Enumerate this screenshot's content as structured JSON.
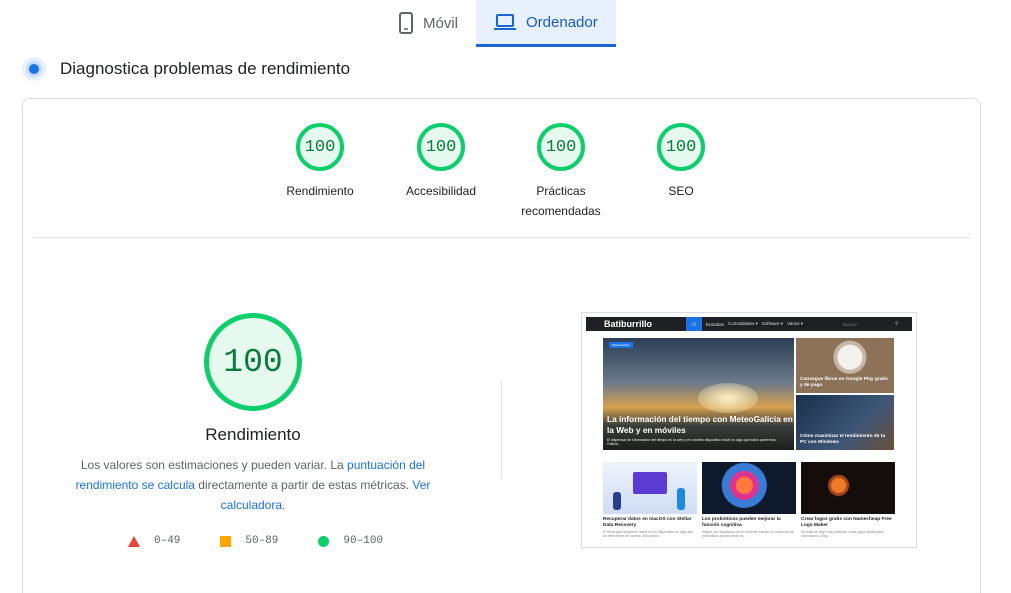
{
  "tabs": [
    {
      "label": "Móvil",
      "icon": "smartphone-icon",
      "active": false
    },
    {
      "label": "Ordenador",
      "icon": "laptop-icon",
      "active": true
    }
  ],
  "header": {
    "title": "Diagnostica problemas de rendimiento"
  },
  "gauges": [
    {
      "score": "100",
      "label": "Rendimiento"
    },
    {
      "score": "100",
      "label": "Accesibilidad"
    },
    {
      "score": "100",
      "label": "Prácticas recomendadas"
    },
    {
      "score": "100",
      "label": "SEO"
    }
  ],
  "main": {
    "score": "100",
    "label": "Rendimiento",
    "desc_1": "Los valores son estimaciones y pueden variar. La ",
    "desc_link_1": "puntuación del rendimiento se calcula",
    "desc_2": " directamente a partir de estas métricas. ",
    "desc_link_2": "Ver calculadora",
    "desc_3": "."
  },
  "legend": [
    {
      "range": "0–49",
      "icon": "fail-triangle-icon",
      "color": "#e8453c"
    },
    {
      "range": "50–89",
      "icon": "average-square-icon",
      "color": "#ffa400"
    },
    {
      "range": "90–100",
      "icon": "pass-circle-icon",
      "color": "#0cce6b"
    }
  ],
  "thumbnail": {
    "brand": "Batiburrillo",
    "menu": [
      "Entradas",
      "Curiosidades ▾",
      "Software ▾",
      "Varios ▾"
    ],
    "search_placeholder": "Buscar",
    "hero_badge": "MeteoGalicia",
    "hero_title": "La información del tiempo con MeteoGalicia en la Web y en móviles",
    "hero_sub": "El dispensar de información del tiempo en la web y en móviles dispositivo móvil no algo que todos queremos. Galicia...",
    "side": [
      {
        "title": "Consegue libros en Google Play gratis y de pago"
      },
      {
        "title": "Cómo maximizar el rendimiento de tu PC con Windows"
      }
    ],
    "cards": [
      {
        "title": "Recuperar datos en macOS con Stellar Data Recovery",
        "text": "El tema que recuperar datos en un dispositivo es algo que se debe tener en cuenta. Encontrar..."
      },
      {
        "title": "Los probióticos pueden mejorar la función cognitiva",
        "text": "Según los resultados de un reciente estudio el consumo de probióticos puede tener un..."
      },
      {
        "title": "Crear logos gratis con Namecheap Free Logo Maker",
        "text": "Se trata de algo muy habitual, crear logos gratis para ordenador o blog..."
      }
    ]
  },
  "colors": {
    "pass": "#0cce6b",
    "accent": "#1a73e8"
  }
}
